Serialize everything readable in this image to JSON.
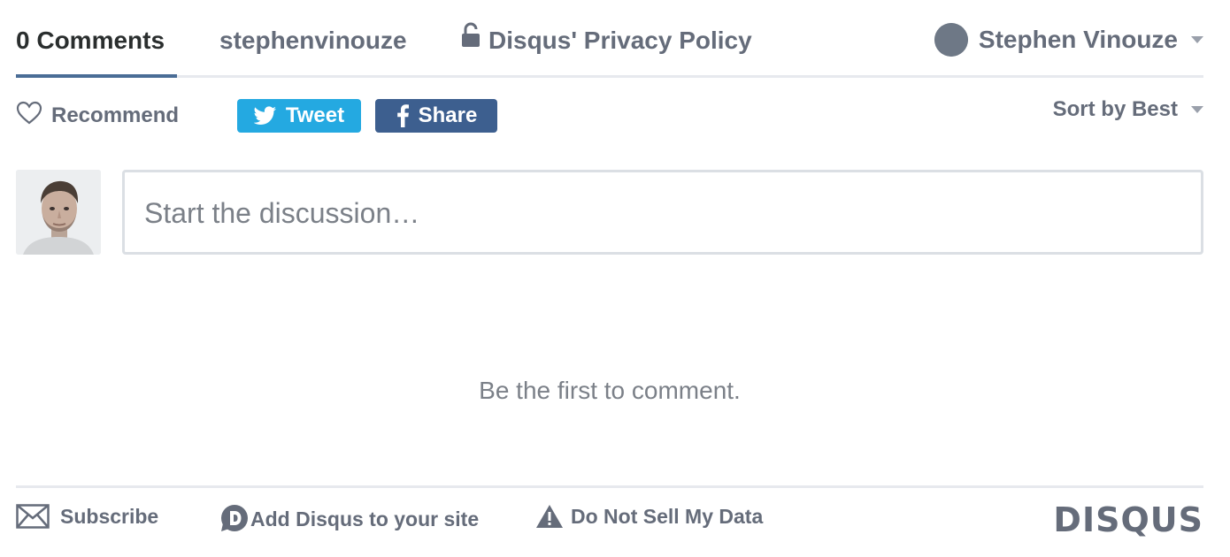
{
  "nav": {
    "comments_tab": "0 Comments",
    "community_tab": "stephenvinouze",
    "privacy_tab": "Disqus' Privacy Policy",
    "user_name": "Stephen Vinouze"
  },
  "actions": {
    "recommend": "Recommend",
    "tweet": "Tweet",
    "share": "Share",
    "sort": "Sort by Best"
  },
  "composer": {
    "placeholder": "Start the discussion…"
  },
  "empty_state": "Be the first to comment.",
  "footer": {
    "subscribe": "Subscribe",
    "add_disqus": "Add Disqus to your site",
    "do_not_sell": "Do Not Sell My Data",
    "brand": "DISQUS"
  },
  "colors": {
    "text": "#656c7a",
    "active_tab": "#2a2e2e",
    "tab_underline": "#4a6d96",
    "tweet": "#24a9e1",
    "facebook": "#3d5f8f",
    "border": "#dbdfe4"
  },
  "icons": [
    "lock-icon",
    "user-avatar",
    "heart-icon",
    "twitter-icon",
    "facebook-icon",
    "envelope-icon",
    "disqus-logo-icon",
    "warning-icon"
  ]
}
